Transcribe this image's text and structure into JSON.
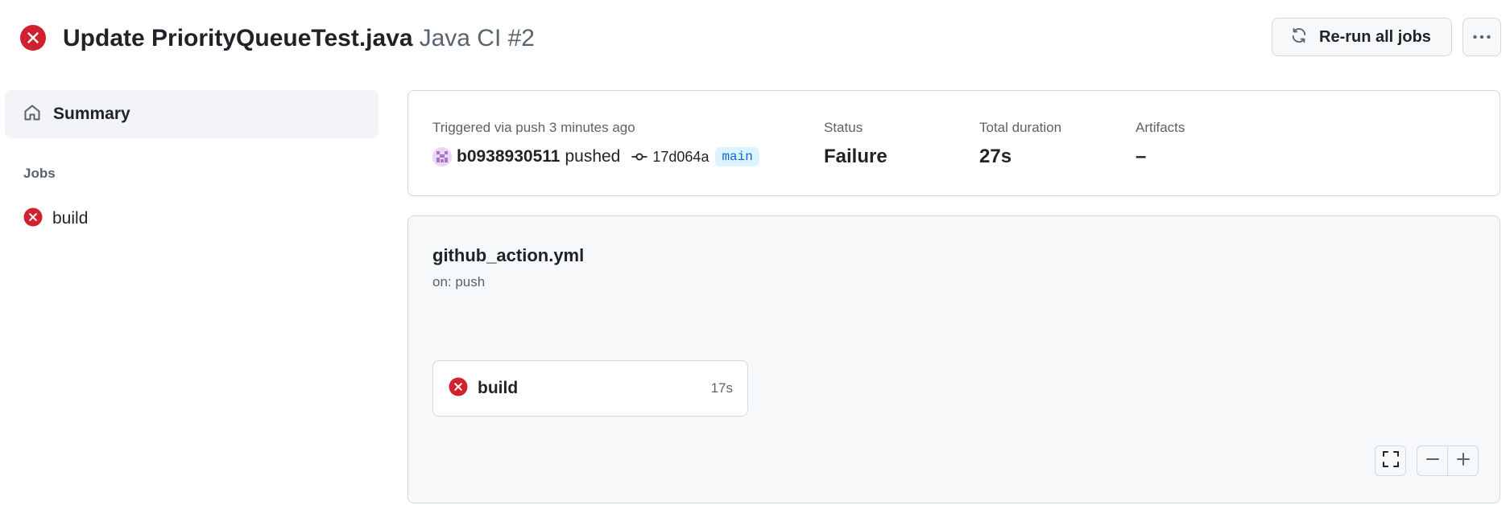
{
  "header": {
    "title": "Update PriorityQueueTest.java",
    "workflow_run": "Java CI #2",
    "rerun_label": "Re-run all jobs",
    "status_icon": "x-circle-fill-icon",
    "more_icon": "kebab-horizontal-icon"
  },
  "sidebar": {
    "summary_label": "Summary",
    "jobs_heading": "Jobs",
    "jobs": [
      {
        "label": "build",
        "status": "failure"
      }
    ]
  },
  "summary": {
    "triggered_text": "Triggered via push 3 minutes ago",
    "user": "b0938930511",
    "action": "pushed",
    "commit_sha": "17d064a",
    "branch": "main",
    "status_label": "Status",
    "status_value": "Failure",
    "duration_label": "Total duration",
    "duration_value": "27s",
    "artifacts_label": "Artifacts",
    "artifacts_value": "–"
  },
  "graph": {
    "workflow_file": "github_action.yml",
    "trigger": "on: push",
    "jobs": [
      {
        "label": "build",
        "duration": "17s",
        "status": "failure"
      }
    ]
  },
  "colors": {
    "failure": "#cf222e",
    "branch_text": "#0969da",
    "branch_bg": "#ddf4ff",
    "muted_text": "#59636e",
    "border": "#d1d9e0",
    "canvas_subtle": "#f6f8fa"
  }
}
